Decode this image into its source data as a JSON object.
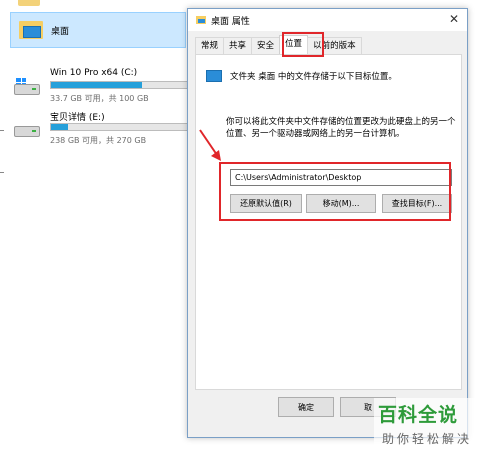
{
  "explorer": {
    "desktop_label": "桌面",
    "drives": [
      {
        "name": "Win 10 Pro x64 (C:)",
        "space": "33.7 GB 可用，共 100 GB",
        "used_fraction": 0.66
      },
      {
        "name": "宝贝详情 (E:)",
        "space": "238 GB 可用，共 270 GB",
        "used_fraction": 0.12
      }
    ]
  },
  "dialog": {
    "title": "桌面 属性",
    "close_glyph": "✕",
    "tabs": [
      "常规",
      "共享",
      "安全",
      "位置",
      "以前的版本"
    ],
    "active_tab": "位置",
    "info_text": "文件夹 桌面 中的文件存储于以下目标位置。",
    "description": "你可以将此文件夹中文件存储的位置更改为此硬盘上的另一个位置、另一个驱动器或网络上的另一台计算机。",
    "path_value": "C:\\Users\\Administrator\\Desktop",
    "buttons": {
      "restore": "还原默认值(R)",
      "move": "移动(M)...",
      "find": "查找目标(F)..."
    },
    "footer": {
      "ok": "确定",
      "cancel": "取"
    }
  },
  "watermark": {
    "title": "百科全说",
    "subtitle": "助你轻松解决"
  },
  "colors": {
    "highlight": "#e0262a",
    "accent": "#26a0da",
    "watermark": "#2e9b3a"
  }
}
